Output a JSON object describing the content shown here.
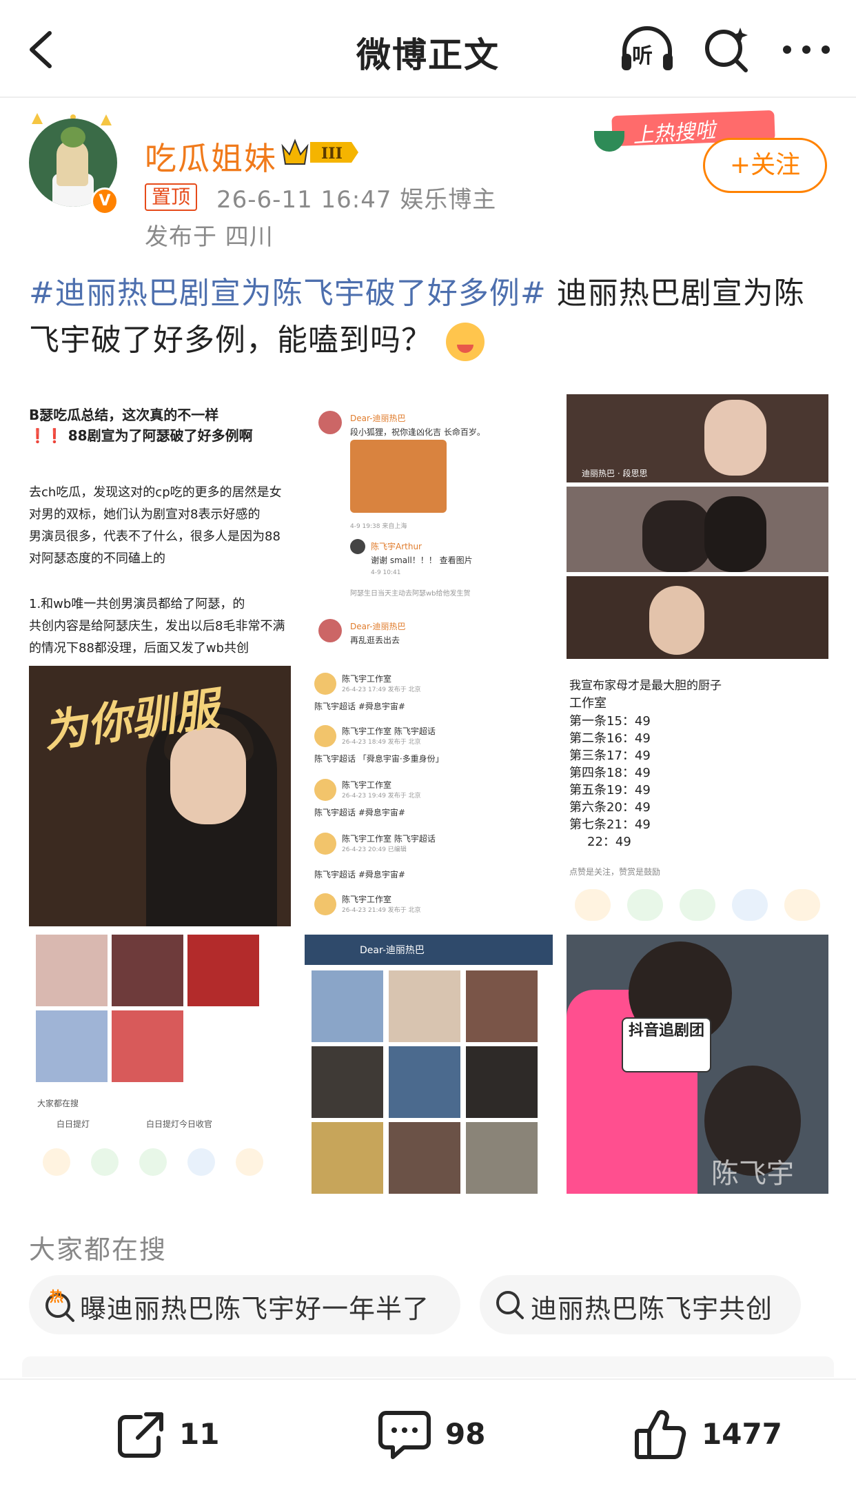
{
  "header": {
    "title": "微博正文",
    "listen_label": "听"
  },
  "author": {
    "name": "吃瓜姐妹",
    "level": "III",
    "pinned_label": "置顶",
    "meta": "26-6-11 16:47  娱乐博主",
    "location": "发布于 四川",
    "verified_mark": "V",
    "hot_banner_text": "上热搜啦",
    "follow_label": "+关注"
  },
  "post": {
    "topic": "#迪丽热巴剧宣为陈飞宇破了好多例#",
    "text_after_topic": " 迪丽热巴剧宣为陈飞宇破了好多例，能嗑到吗？"
  },
  "images": {
    "img1_lines": [
      "B瑟吃瓜总结，这次真的不一样",
      "❗❗ 88剧宣为了阿瑟破了好多例啊",
      "去ch吃瓜，发现这对的cp吃的更多的居然是女",
      "对男的双标，她们认为剧宣对8表示好感的",
      "男演员很多，代表不了什么，很多人是因为88",
      "对阿瑟态度的不同磕上的",
      "1.和wb唯一共创男演员都给了阿瑟，的",
      "共创内容是给阿瑟庆生，发出以后8毛非常不满",
      "的情况下88都没理，后面又发了wb共创"
    ],
    "img2": {
      "name1": "Dear-迪丽热巴",
      "text1": "段小狐狸，祝你逢凶化吉 长命百岁。",
      "meta1": "4-9 19:38  来自上海",
      "name2": "陈飞宇Arthur",
      "text2": "谢谢 small！！！  查看图片",
      "meta2": "4-9 10:41",
      "note": "阿瑟生日当天主动去阿瑟wb给他发生贺",
      "name3": "Dear-迪丽热巴",
      "text3": "再乱逛丢出去"
    },
    "img3_caption": "迪丽热巴 · 段思思",
    "img4_title": "为你驯服",
    "img5": {
      "rows": [
        {
          "name": "陈飞宇工作室",
          "date": "26-4-23 17:49  发布于 北京",
          "tag": "陈飞宇超话 #舜息宇宙#"
        },
        {
          "name": "陈飞宇工作室  陈飞宇超话",
          "date": "26-4-23 18:49  发布于 北京",
          "tag": "陈飞宇超话 「舜息宇宙·多重身份」"
        },
        {
          "name": "陈飞宇工作室",
          "date": "26-4-23 19:49  发布于 北京",
          "tag": "陈飞宇超话 #舜息宇宙#"
        },
        {
          "name": "陈飞宇工作室  陈飞宇超话",
          "date": "26-4-23 20:49  已编辑",
          "tag": "陈飞宇超话 #舜息宇宙#"
        },
        {
          "name": "陈飞宇工作室",
          "date": "26-4-23 21:49  发布于 北京",
          "tag": ""
        }
      ]
    },
    "img6_lines": [
      "我宣布家母才是最大胆的厨子",
      "工作室",
      "第一条15：49",
      "第二条16：49",
      "第三条17：49",
      "第四条18：49",
      "第五条19：49",
      "第六条20：49",
      "第七条21：49",
      "22：49",
      "点赞是关注，赞赏是鼓励"
    ],
    "img7": {
      "search_label": "大家都在搜",
      "chip1": "白日提灯",
      "chip2": "白日提灯今日收官"
    },
    "img8_title": "Dear-迪丽热巴",
    "img9": {
      "card_text": "抖音追剧团",
      "watermark": "陈飞宇"
    }
  },
  "search_section": {
    "heading": "大家都在搜",
    "chips": [
      {
        "text": "曝迪丽热巴陈飞宇好一年半了",
        "icon": "hot-search-icon"
      },
      {
        "text": "迪丽热巴陈飞宇共创",
        "icon": "search-icon"
      }
    ]
  },
  "bottom_bar": {
    "share_count": "11",
    "comment_count": "98",
    "like_count": "1477"
  },
  "colors": {
    "accent_orange": "#ff8200",
    "topic_blue": "#4d6fae",
    "author_name": "#f07a1b"
  }
}
